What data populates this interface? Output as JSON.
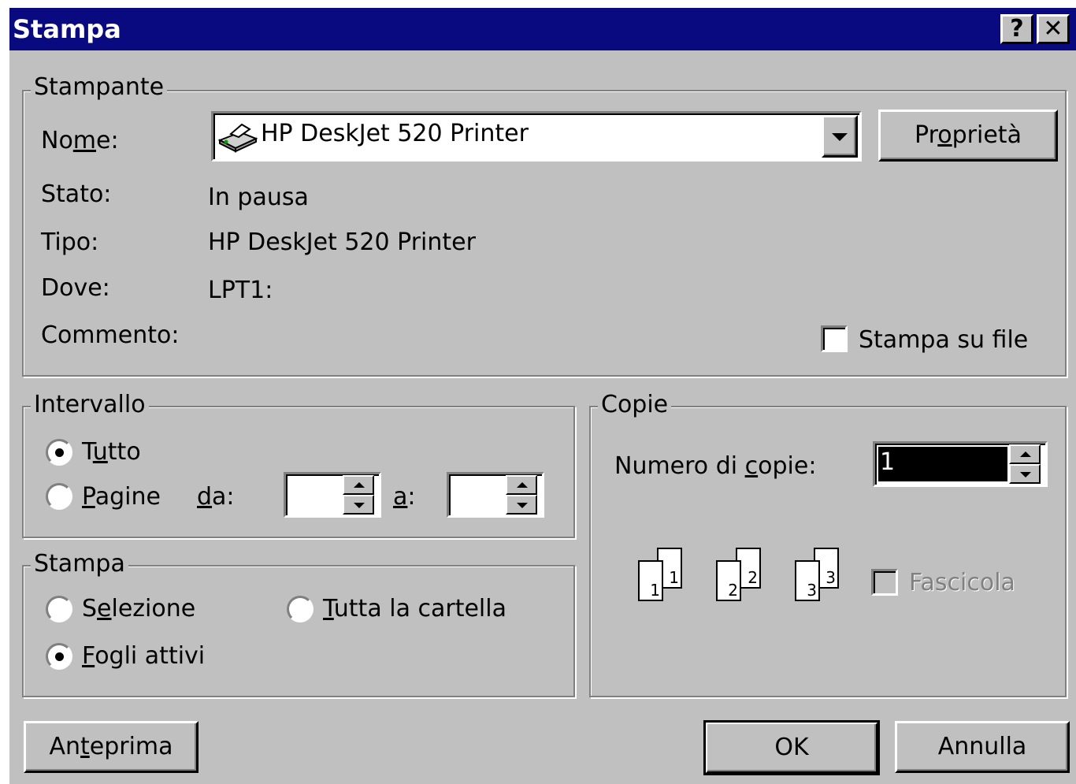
{
  "window": {
    "title": "Stampa",
    "help_glyph": "?",
    "close_glyph": "✕"
  },
  "printer": {
    "group_label": "Stampante",
    "name_label_pre": "No",
    "name_label_u": "m",
    "name_label_post": "e:",
    "name_value": "HP DeskJet 520 Printer",
    "properties_pre": "Pr",
    "properties_u": "o",
    "properties_post": "prietà",
    "status_label": "Stato:",
    "status_value": "In pausa",
    "type_label": "Tipo:",
    "type_value": "HP DeskJet 520 Printer",
    "where_label": "Dove:",
    "where_value": "LPT1:",
    "comment_label": "Commento:",
    "print_to_file_pre": "Stampa su f",
    "print_to_file_u": "i",
    "print_to_file_post": "le"
  },
  "range": {
    "group_label": "Intervallo",
    "all_pre": "T",
    "all_u": "u",
    "all_post": "tto",
    "pages_u": "P",
    "pages_post": "agine",
    "from_u": "d",
    "from_post": "a:",
    "to_u": "a",
    "to_post": ":",
    "from_value": "",
    "to_value": ""
  },
  "print_what": {
    "group_label": "Stampa",
    "selection_pre": "S",
    "selection_u": "e",
    "selection_post": "lezione",
    "workbook_u": "T",
    "workbook_post": "utta la cartella",
    "active_sheets_u": "F",
    "active_sheets_post": "ogli attivi"
  },
  "copies": {
    "group_label": "Copie",
    "number_pre": "Numero di ",
    "number_u": "c",
    "number_post": "opie:",
    "number_value": "1",
    "collate_label": "Fascicola",
    "page_numbers": [
      "1",
      "2",
      "3"
    ]
  },
  "buttons": {
    "preview_pre": "An",
    "preview_u": "t",
    "preview_post": "eprima",
    "ok": "OK",
    "cancel": "Annulla"
  },
  "state": {
    "selected_range": "Tutto",
    "selected_print": "Fogli attivi",
    "print_to_file": false,
    "collate": false
  }
}
